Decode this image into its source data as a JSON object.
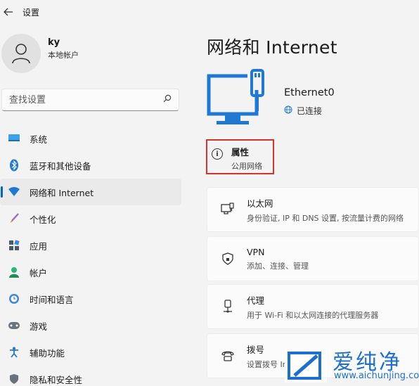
{
  "window": {
    "back_icon": "back-arrow-icon",
    "title": "设置"
  },
  "profile": {
    "name": "ky",
    "account_type": "本地帐户"
  },
  "search": {
    "placeholder": "查找设置"
  },
  "nav": {
    "items": [
      {
        "label": "系统",
        "icon": "system-icon",
        "active": false
      },
      {
        "label": "蓝牙和其他设备",
        "icon": "bluetooth-icon",
        "active": false
      },
      {
        "label": "网络和 Internet",
        "icon": "network-icon",
        "active": true
      },
      {
        "label": "个性化",
        "icon": "brush-icon",
        "active": false
      },
      {
        "label": "应用",
        "icon": "apps-icon",
        "active": false
      },
      {
        "label": "帐户",
        "icon": "account-icon",
        "active": false
      },
      {
        "label": "时间和语言",
        "icon": "time-language-icon",
        "active": false
      },
      {
        "label": "游戏",
        "icon": "gaming-icon",
        "active": false
      },
      {
        "label": "辅助功能",
        "icon": "accessibility-icon",
        "active": false
      },
      {
        "label": "隐私和安全性",
        "icon": "privacy-icon",
        "active": false
      }
    ]
  },
  "main": {
    "title": "网络和 Internet",
    "adapter": {
      "name": "Ethernet0",
      "status": "已连接"
    },
    "properties": {
      "title": "属性",
      "subtitle": "公用网络"
    },
    "cards": [
      {
        "title": "以太网",
        "desc": "身份验证, IP 和 DNS 设置, 按流量计费的网络",
        "icon": "ethernet-icon"
      },
      {
        "title": "VPN",
        "desc": "添加、连接、管理",
        "icon": "vpn-shield-icon"
      },
      {
        "title": "代理",
        "desc": "用于 Wi-Fi 和以太网连接的代理服务器",
        "icon": "proxy-icon"
      },
      {
        "title": "拨号",
        "desc": "设置拨号 Ir",
        "icon": "dialup-icon"
      }
    ]
  },
  "watermark": {
    "title": "爱纯净",
    "url": "www.aichunjing.com"
  },
  "colors": {
    "accent": "#0067c0",
    "highlight_border": "#d9342b",
    "watermark": "#1a6fd0"
  }
}
